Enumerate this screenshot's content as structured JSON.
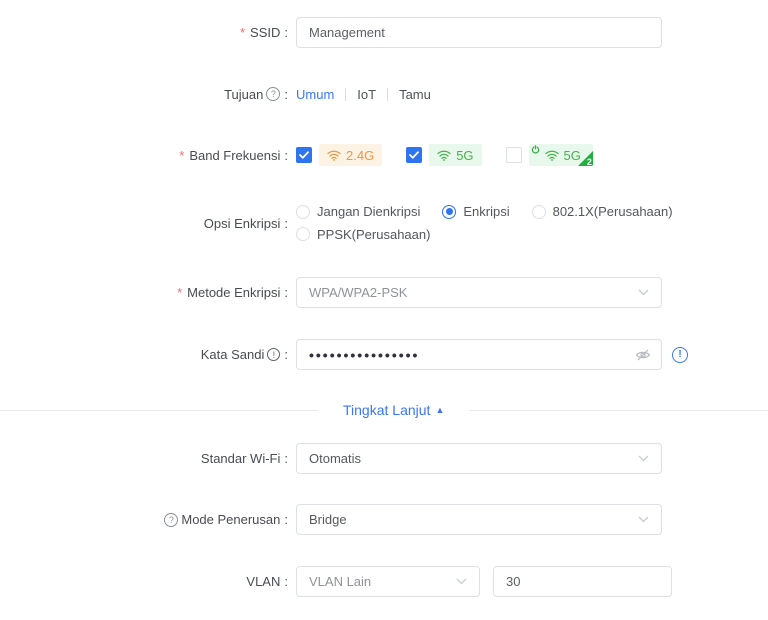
{
  "ui": {
    "required_marker": "*",
    "colon": ":"
  },
  "icons": {
    "help": "?",
    "info": "!"
  },
  "colors": {
    "primary_blue": "#3A76F6",
    "checkbox_blue": "#2E74F0",
    "required_red": "#F56C6C",
    "badge_24g_text": "#F0953C",
    "badge_24g_bg": "#FDF3E5",
    "badge_5g_text": "#44B549",
    "badge_5g_bg": "#E9F8EC",
    "badge_corner_green": "#1FAF3E",
    "input_border": "#DCDFE6"
  },
  "form": {
    "ssid": {
      "label": "SSID",
      "value": "Management"
    },
    "tujuan": {
      "label": "Tujuan",
      "options": [
        {
          "label": "Umum",
          "selected": true
        },
        {
          "label": "IoT",
          "selected": false
        },
        {
          "label": "Tamu",
          "selected": false
        }
      ]
    },
    "band": {
      "label": "Band Frekuensi",
      "items": [
        {
          "label": "2.4G",
          "checked": true
        },
        {
          "label": "5G",
          "checked": true
        },
        {
          "label": "5G",
          "sub": "2",
          "checked": false
        }
      ]
    },
    "opsi": {
      "label": "Opsi Enkripsi",
      "options": [
        {
          "label": "Jangan Dienkripsi",
          "selected": false
        },
        {
          "label": "Enkripsi",
          "selected": true
        },
        {
          "label": "802.1X(Perusahaan)",
          "selected": false
        },
        {
          "label": "PPSK(Perusahaan)",
          "selected": false
        }
      ]
    },
    "metode": {
      "label": "Metode Enkripsi",
      "value": "WPA/WPA2-PSK"
    },
    "sandi": {
      "label": "Kata Sandi",
      "value": "••••••••••••••••"
    },
    "advanced": {
      "label": "Tingkat Lanjut",
      "arrow": "▲"
    },
    "standar": {
      "label": "Standar Wi-Fi",
      "value": "Otomatis"
    },
    "mode": {
      "label": "Mode Penerusan",
      "value": "Bridge"
    },
    "vlan": {
      "label": "VLAN",
      "select_value": "VLAN Lain",
      "vlan_id": "30"
    }
  }
}
